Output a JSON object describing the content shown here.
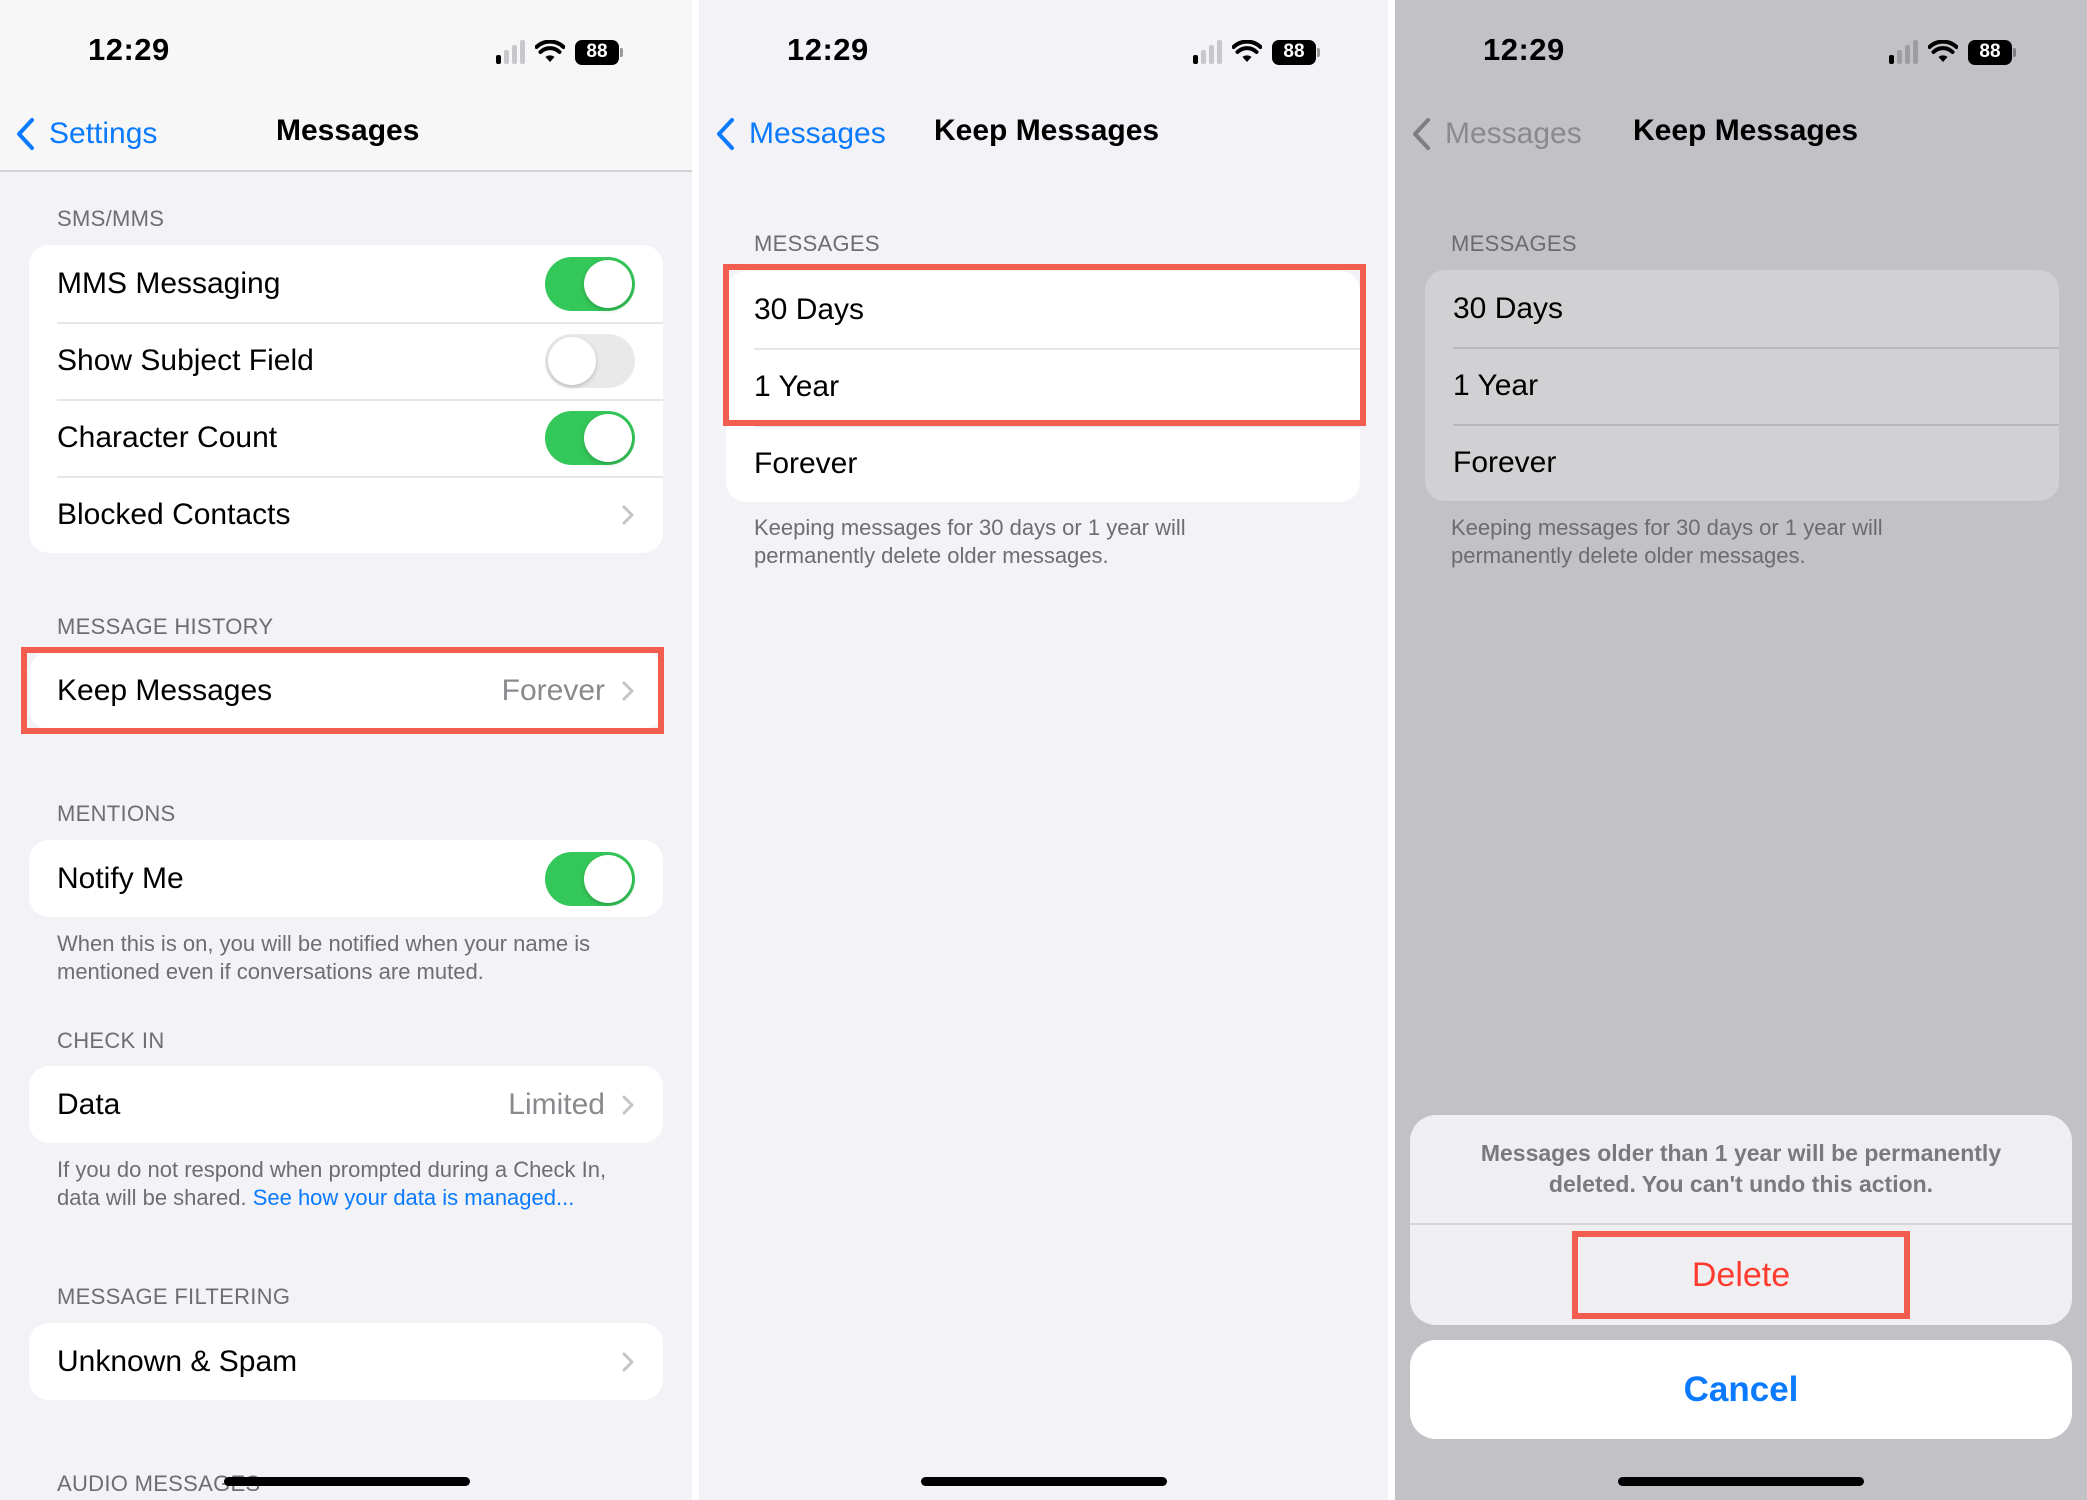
{
  "status_bar": {
    "time": "12:29",
    "battery": "88",
    "signal_bars_active": 1,
    "signal_bars_total": 4
  },
  "colors": {
    "accent": "#0a7aff",
    "toggle_on": "#34c759",
    "destructive": "#ff3b30",
    "highlight": "#f25d50"
  },
  "panel1": {
    "back_label": "Settings",
    "title": "Messages",
    "sections": {
      "sms": {
        "header": "SMS/MMS",
        "rows": [
          {
            "label": "MMS Messaging",
            "toggle": "on"
          },
          {
            "label": "Show Subject Field",
            "toggle": "off"
          },
          {
            "label": "Character Count",
            "toggle": "on"
          },
          {
            "label": "Blocked Contacts"
          }
        ]
      },
      "history": {
        "header": "MESSAGE HISTORY",
        "row": {
          "label": "Keep Messages",
          "value": "Forever"
        }
      },
      "mentions": {
        "header": "MENTIONS",
        "row": {
          "label": "Notify Me",
          "toggle": "on"
        },
        "footer": "When this is on, you will be notified when your name is mentioned even if conversations are muted."
      },
      "checkin": {
        "header": "CHECK IN",
        "row": {
          "label": "Data",
          "value": "Limited"
        },
        "footer": "If you do not respond when prompted during a Check In, data will be shared.",
        "footer_link": "See how your data is managed..."
      },
      "filtering": {
        "header": "MESSAGE FILTERING",
        "row": {
          "label": "Unknown & Spam"
        }
      },
      "audio": {
        "header": "AUDIO MESSAGES"
      }
    }
  },
  "panel2": {
    "back_label": "Messages",
    "title": "Keep Messages",
    "section_header": "MESSAGES",
    "options": [
      "30 Days",
      "1 Year",
      "Forever"
    ],
    "footer": "Keeping messages for 30 days or 1 year will permanently delete older messages."
  },
  "panel3": {
    "back_label": "Messages",
    "title": "Keep Messages",
    "section_header": "MESSAGES",
    "options": [
      "30 Days",
      "1 Year",
      "Forever"
    ],
    "footer": "Keeping messages for 30 days or 1 year will permanently delete older messages.",
    "action_sheet": {
      "message": "Messages older than 1 year will be permanently deleted. You can't undo this action.",
      "delete_label": "Delete",
      "cancel_label": "Cancel"
    }
  }
}
